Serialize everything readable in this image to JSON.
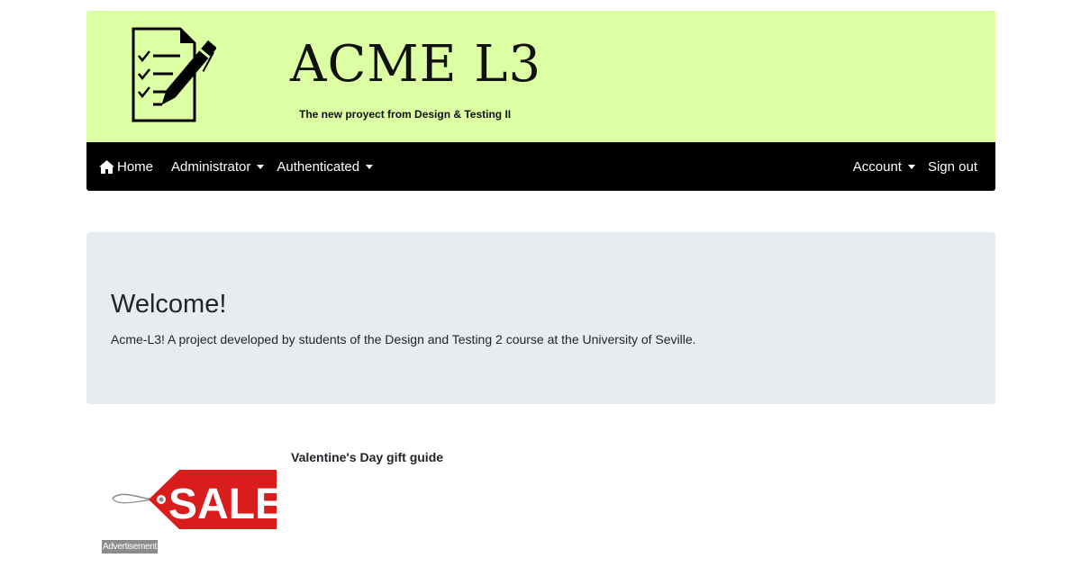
{
  "header": {
    "title": "ACME L3",
    "subtitle": "The new proyect from Design & Testing II",
    "brand_color": "#dbffa2"
  },
  "navbar": {
    "left": [
      {
        "label": "Home",
        "icon": "home-icon"
      },
      {
        "label": "Administrator",
        "icon": "caret-down-icon"
      },
      {
        "label": "Authenticated",
        "icon": "caret-down-icon"
      }
    ],
    "right": [
      {
        "label": "Account",
        "icon": "caret-down-icon"
      },
      {
        "label": "Sign out"
      }
    ],
    "background": "#000000"
  },
  "jumbotron": {
    "title": "Welcome!",
    "text": "Acme-L3! A project developed by students of the Design and Testing 2 course at the University of Seville.",
    "background": "#e9ecef"
  },
  "advertisement": {
    "title": "Valentine's Day gift guide",
    "image_text": "SALE",
    "label": "Advertisement",
    "tag_color": "#d91c1c"
  }
}
